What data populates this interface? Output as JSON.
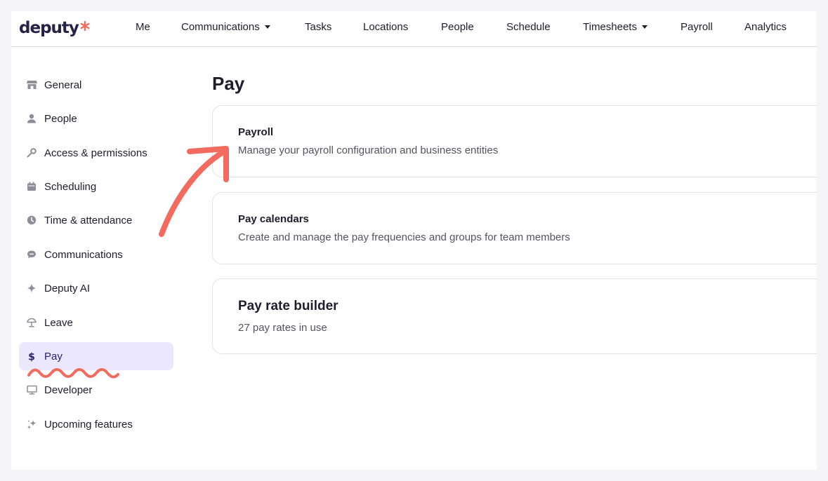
{
  "brand": {
    "name": "deputy",
    "accent": "#f26b5e",
    "logo_color": "#262247"
  },
  "topnav": {
    "items": [
      {
        "label": "Me",
        "dropdown": false
      },
      {
        "label": "Communications",
        "dropdown": true
      },
      {
        "label": "Tasks",
        "dropdown": false
      },
      {
        "label": "Locations",
        "dropdown": false
      },
      {
        "label": "People",
        "dropdown": false
      },
      {
        "label": "Schedule",
        "dropdown": false
      },
      {
        "label": "Timesheets",
        "dropdown": true
      },
      {
        "label": "Payroll",
        "dropdown": false
      },
      {
        "label": "Analytics",
        "dropdown": false
      }
    ]
  },
  "sidebar": {
    "active_bg": "#ebe7fc",
    "items": [
      {
        "label": "General",
        "icon": "store-icon"
      },
      {
        "label": "People",
        "icon": "person-icon"
      },
      {
        "label": "Access & permissions",
        "icon": "key-icon"
      },
      {
        "label": "Scheduling",
        "icon": "calendar-icon"
      },
      {
        "label": "Time & attendance",
        "icon": "clock-icon"
      },
      {
        "label": "Communications",
        "icon": "chat-icon"
      },
      {
        "label": "Deputy AI",
        "icon": "sparkle-icon"
      },
      {
        "label": "Leave",
        "icon": "umbrella-icon"
      },
      {
        "label": "Pay",
        "icon": "dollar-icon",
        "active": true
      },
      {
        "label": "Developer",
        "icon": "monitor-icon"
      },
      {
        "label": "Upcoming features",
        "icon": "sparkles-icon"
      }
    ]
  },
  "main": {
    "title": "Pay",
    "cards": [
      {
        "title": "Payroll",
        "description": "Manage your payroll configuration and business entities"
      },
      {
        "title": "Pay calendars",
        "description": "Create and manage the pay frequencies and groups for team members"
      },
      {
        "title": "Pay rate builder",
        "description": "27 pay rates in use"
      }
    ]
  },
  "annotations": {
    "color": "#f26b5e",
    "items": [
      "arrow-to-payroll",
      "squiggle-under-pay"
    ]
  }
}
